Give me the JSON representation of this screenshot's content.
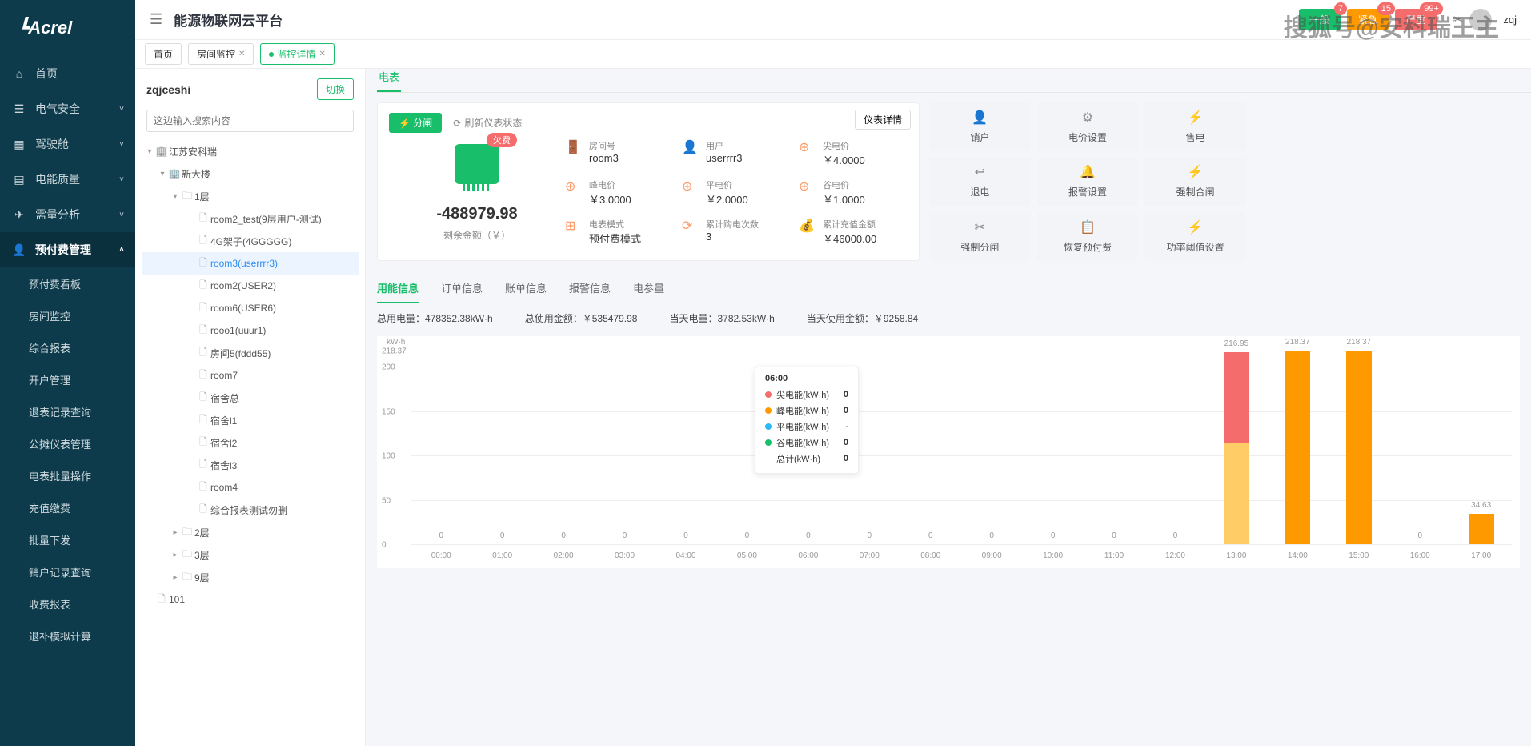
{
  "logo": "Acrel",
  "platform_title": "能源物联网云平台",
  "watermark": "搜狐号@安科瑞王主",
  "user_name": "zqj",
  "alerts": [
    {
      "label": "一般",
      "count": "7",
      "color": "#19be6b"
    },
    {
      "label": "紧急",
      "count": "15",
      "color": "#ff9900"
    },
    {
      "label": "严重",
      "count": "99+",
      "color": "#f56c6c"
    }
  ],
  "top_tabs": [
    {
      "label": "首页",
      "active": false,
      "closable": false
    },
    {
      "label": "房间监控",
      "active": false,
      "closable": true
    },
    {
      "label": "监控详情",
      "active": true,
      "closable": true
    }
  ],
  "sidebar": {
    "items": [
      {
        "label": "首页",
        "icon": "⌂",
        "expandable": false
      },
      {
        "label": "电气安全",
        "icon": "☰",
        "expandable": true
      },
      {
        "label": "驾驶舱",
        "icon": "▦",
        "expandable": true
      },
      {
        "label": "电能质量",
        "icon": "▤",
        "expandable": true
      },
      {
        "label": "需量分析",
        "icon": "✈",
        "expandable": true
      },
      {
        "label": "预付费管理",
        "icon": "👤",
        "expandable": true,
        "active": true
      }
    ],
    "subs": [
      "预付费看板",
      "房间监控",
      "综合报表",
      "开户管理",
      "退表记录查询",
      "公摊仪表管理",
      "电表批量操作",
      "充值缴费",
      "批量下发",
      "销户记录查询",
      "收费报表",
      "退补模拟计算"
    ]
  },
  "tree": {
    "title": "zqjceshi",
    "switch": "切换",
    "search_placeholder": "这边输入搜索内容",
    "root": "江苏安科瑞",
    "building": "新大楼",
    "floor1": "1层",
    "rooms_f1": [
      "room2_test(9层用户-测试)",
      "4G架子(4GGGGG)",
      "room3(userrrr3)",
      "room2(USER2)",
      "room6(USER6)",
      "rooo1(uuur1)",
      "房间5(fddd55)",
      "room7",
      "宿舍总",
      "宿舍l1",
      "宿舍l2",
      "宿舍l3",
      "room4",
      "综合报表测试勿删"
    ],
    "other_floors": [
      "2层",
      "3层",
      "9层"
    ],
    "extra": "101"
  },
  "section": "电表",
  "meter": {
    "close_btn": "分闸",
    "refresh": "刷新仪表状态",
    "detail_btn": "仪表详情",
    "owe_badge": "欠费",
    "balance": "-488979.98",
    "balance_label": "剩余金额（￥）",
    "info": [
      {
        "label": "房间号",
        "value": "room3"
      },
      {
        "label": "用户",
        "value": "userrrr3"
      },
      {
        "label": "尖电价",
        "value": "￥4.0000"
      },
      {
        "label": "峰电价",
        "value": "￥3.0000"
      },
      {
        "label": "平电价",
        "value": "￥2.0000"
      },
      {
        "label": "谷电价",
        "value": "￥1.0000"
      },
      {
        "label": "电表模式",
        "value": "预付费模式"
      },
      {
        "label": "累计购电次数",
        "value": "3"
      },
      {
        "label": "累计充值金额",
        "value": "￥46000.00"
      }
    ]
  },
  "btns": [
    "销户",
    "电价设置",
    "售电",
    "退电",
    "报警设置",
    "强制合闸",
    "强制分闸",
    "恢复预付费",
    "功率阈值设置"
  ],
  "inner_tabs": [
    "用能信息",
    "订单信息",
    "账单信息",
    "报警信息",
    "电参量"
  ],
  "stats": [
    {
      "label": "总用电量：",
      "value": "478352.38kW·h"
    },
    {
      "label": "总使用金额：",
      "value": "￥535479.98"
    },
    {
      "label": "当天电量：",
      "value": "3782.53kW·h"
    },
    {
      "label": "当天使用金额：",
      "value": "￥9258.84"
    }
  ],
  "tooltip": {
    "time": "06:00",
    "rows": [
      {
        "label": "尖电能(kW·h)",
        "value": "0",
        "color": "#f56c6c"
      },
      {
        "label": "峰电能(kW·h)",
        "value": "0",
        "color": "#ff9900"
      },
      {
        "label": "平电能(kW·h)",
        "value": "-",
        "color": "#2db7f5"
      },
      {
        "label": "谷电能(kW·h)",
        "value": "0",
        "color": "#19be6b"
      },
      {
        "label": "总计(kW·h)",
        "value": "0",
        "color": ""
      }
    ]
  },
  "chart_data": {
    "type": "bar",
    "unit": "kW·h",
    "ymax": 218.37,
    "yticks": [
      0,
      50,
      100,
      150,
      200,
      218.37
    ],
    "categories": [
      "00:00",
      "01:00",
      "02:00",
      "03:00",
      "04:00",
      "05:00",
      "06:00",
      "07:00",
      "08:00",
      "09:00",
      "10:00",
      "11:00",
      "12:00",
      "13:00",
      "14:00",
      "15:00",
      "16:00",
      "17:00"
    ],
    "series": [
      {
        "name": "尖电能",
        "color": "#f56c6c",
        "values": [
          0,
          0,
          0,
          0,
          0,
          0,
          0,
          0,
          0,
          0,
          0,
          0,
          0,
          102,
          0,
          0,
          0,
          0
        ]
      },
      {
        "name": "峰电能",
        "color": "#ff9900",
        "values": [
          0,
          0,
          0,
          0,
          0,
          0,
          0,
          0,
          0,
          0,
          0,
          0,
          0,
          0,
          218.37,
          218.37,
          0,
          34.63
        ]
      },
      {
        "name": "平电能",
        "color": "#2db7f5",
        "values": [
          0,
          0,
          0,
          0,
          0,
          0,
          0,
          0,
          0,
          0,
          0,
          0,
          0,
          0,
          0,
          0,
          0,
          0
        ]
      },
      {
        "name": "谷电能",
        "color": "#ffcc66",
        "values": [
          0,
          0,
          0,
          0,
          0,
          0,
          0,
          0,
          0,
          0,
          0,
          0,
          0,
          114.95,
          0,
          0,
          0,
          0
        ]
      }
    ],
    "totals": [
      0,
      0,
      0,
      0,
      0,
      0,
      0,
      0,
      0,
      0,
      0,
      0,
      0,
      216.95,
      218.37,
      218.37,
      0,
      34.63
    ],
    "tooltip_index": 6
  }
}
